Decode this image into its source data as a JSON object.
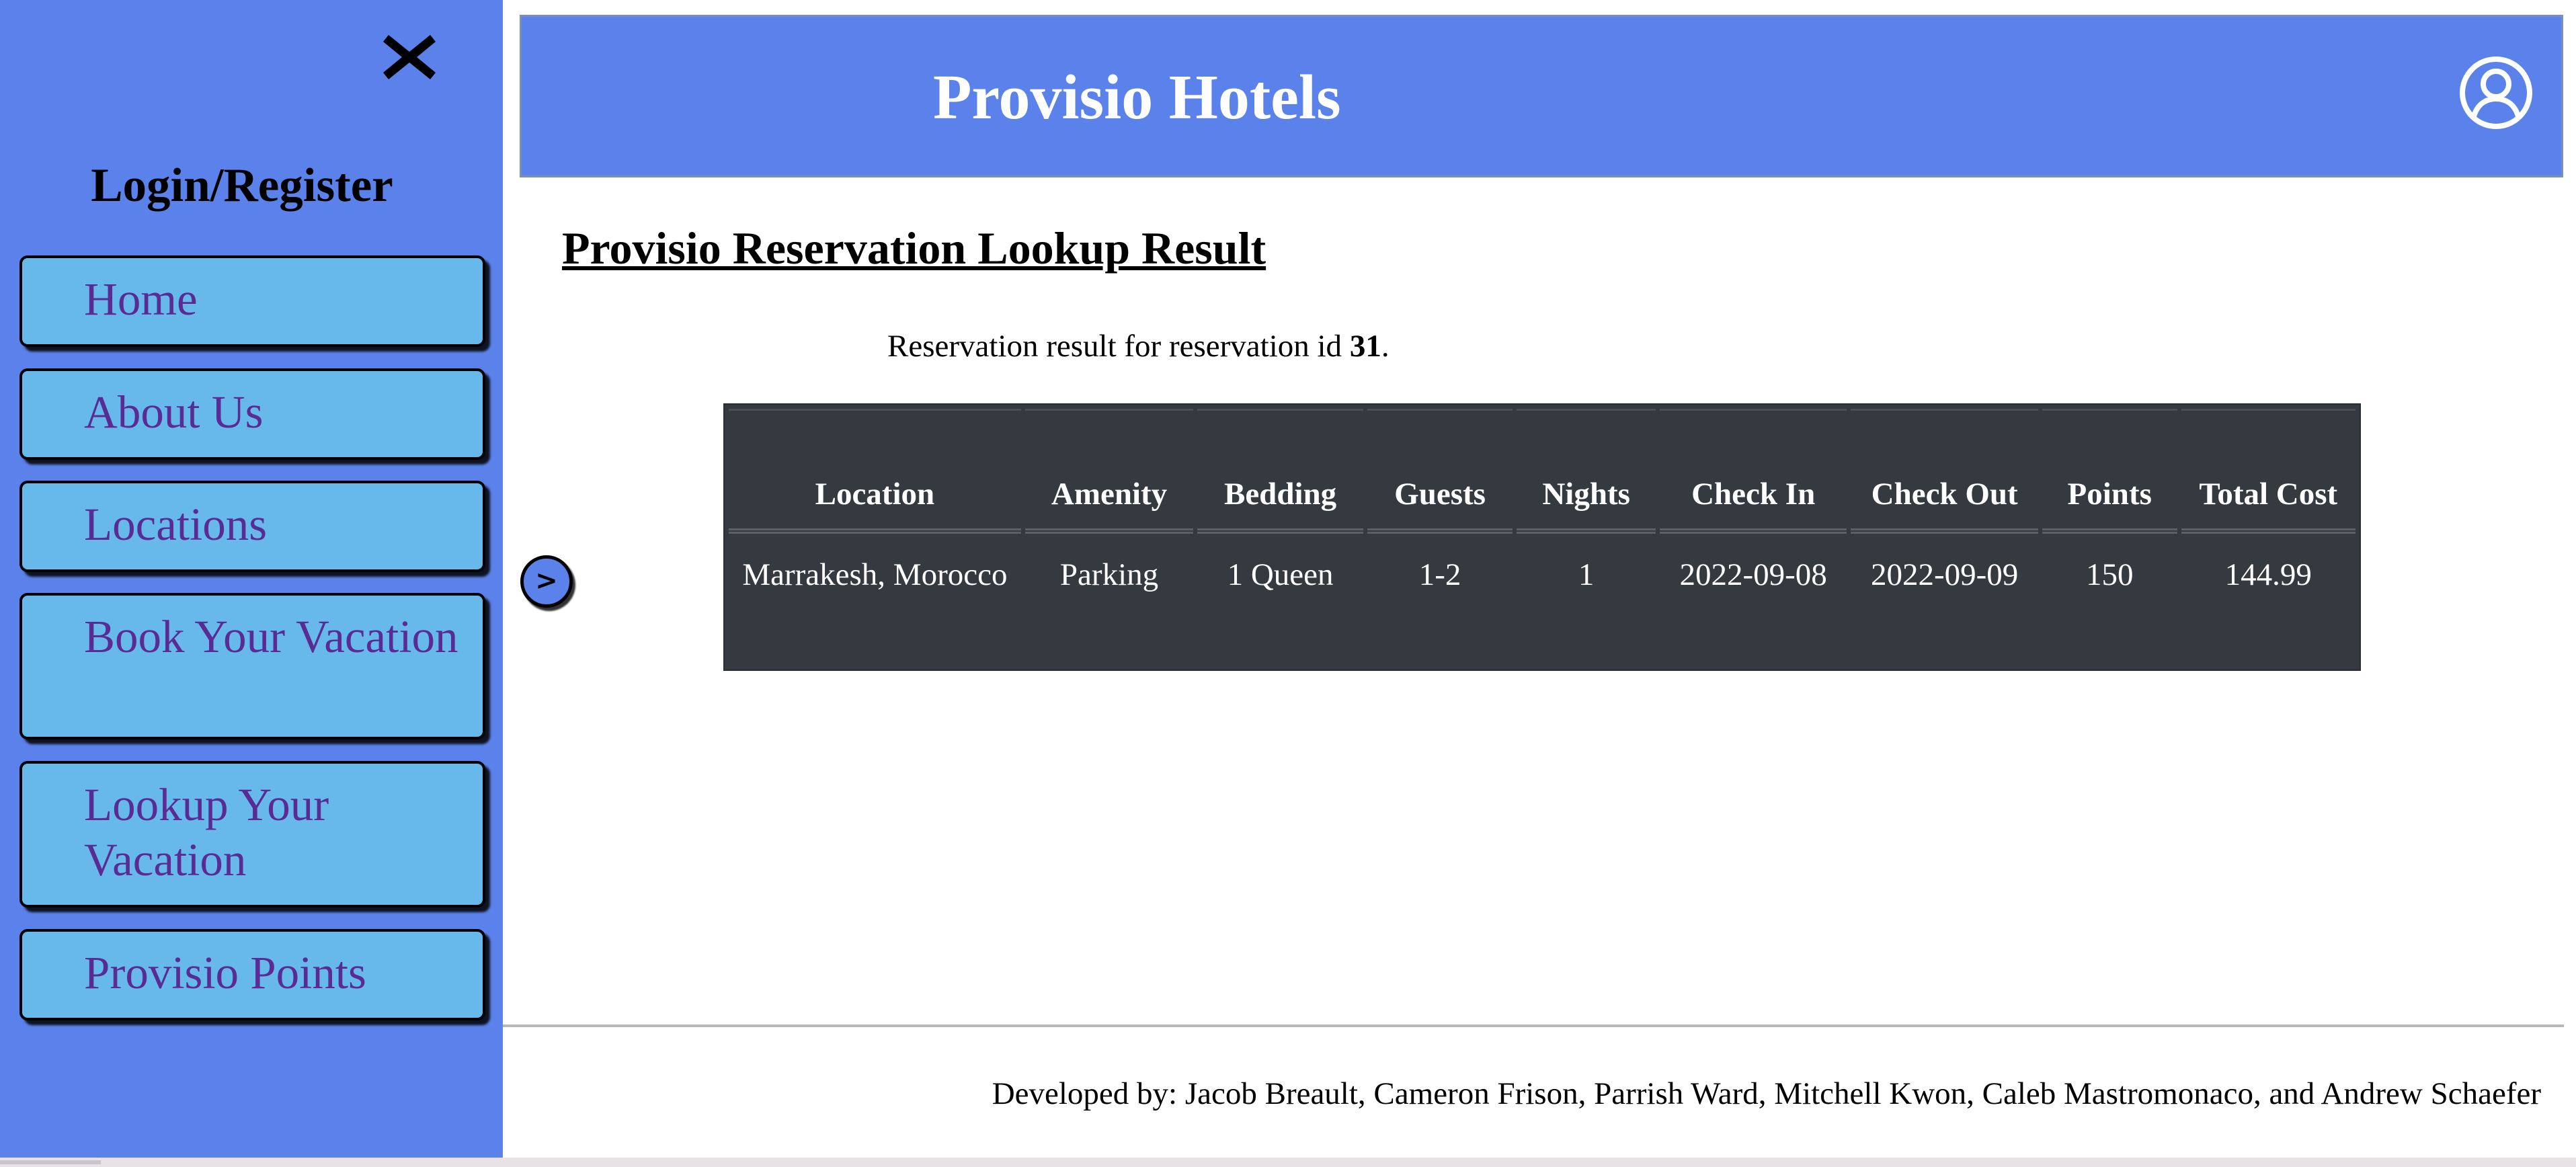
{
  "sidebar": {
    "close_icon": "close-x-icon",
    "login_register": "Login/Register",
    "nav": {
      "home": "Home",
      "about": "About Us",
      "locations": "Locations",
      "book": "Book Your Vacation",
      "lookup": "Lookup Your Vacation",
      "points": "Provisio Points"
    }
  },
  "header": {
    "title": "Provisio Hotels",
    "user_icon": "user-circle-icon"
  },
  "main": {
    "heading": "Provisio Reservation Lookup Result",
    "result_prefix": "Reservation result for reservation id ",
    "reservation_id": "31",
    "result_suffix": ".",
    "expand_button": ">",
    "table": {
      "headers": {
        "location": "Location",
        "amenity": "Amenity",
        "bedding": "Bedding",
        "guests": "Guests",
        "nights": "Nights",
        "check_in": "Check In",
        "check_out": "Check Out",
        "points": "Points",
        "total_cost": "Total Cost"
      },
      "rows": [
        {
          "location": "Marrakesh, Morocco",
          "amenity": "Parking",
          "bedding": "1 Queen",
          "guests": "1-2",
          "nights": "1",
          "check_in": "2022-09-08",
          "check_out": "2022-09-09",
          "points": "150",
          "total_cost": "144.99"
        }
      ]
    }
  },
  "footer": {
    "credits": "Developed by: Jacob Breault, Cameron Frison, Parrish Ward, Mitchell Kwon, Caleb Mastromonaco, and Andrew Schaefer"
  },
  "colors": {
    "primary_blue": "#5b82ea",
    "nav_button": "#67b9ec",
    "nav_text": "#5a2b93",
    "table_bg": "#343a40"
  }
}
